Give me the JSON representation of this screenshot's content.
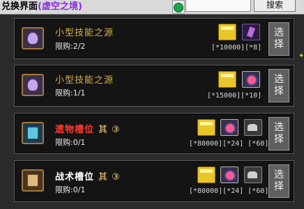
{
  "header": {
    "title": "兑换界面",
    "subtitle": "(虚空之境)",
    "search_button": "搜索",
    "search_value": ""
  },
  "rows": [
    {
      "name": "小型技能之源",
      "suffix": "",
      "limit": "限购:2/2",
      "cost_text": "[*10000][*8]",
      "cost_icons": [
        "gold-bar-icon",
        "purple-crystal-icon"
      ],
      "select_label_1": "选",
      "select_label_2": "择"
    },
    {
      "name": "小型技能之源",
      "suffix": "",
      "limit": "限购:1/1",
      "cost_text": "[*15000][*10]",
      "cost_icons": [
        "gold-bar-icon",
        "void-orb-icon"
      ],
      "select_label_1": "选",
      "select_label_2": "择"
    },
    {
      "name": "遗物槽位",
      "suffix": "其 ③",
      "limit": "限购:0/1",
      "cost_text": "[*80000][*24] [*60]",
      "cost_icons": [
        "gold-bar-icon",
        "void-orb-icon",
        "stone-icon"
      ],
      "select_label_1": "选",
      "select_label_2": "择"
    },
    {
      "name": "战术槽位",
      "suffix": "其 ③",
      "limit": "限购:0/1",
      "cost_text": "[*80000][*24] [*60]",
      "cost_icons": [
        "gold-bar-icon",
        "void-orb-icon",
        "stone-icon"
      ],
      "select_label_1": "选",
      "select_label_2": "择"
    }
  ],
  "colors": {
    "name_gold": "#d2b04a",
    "name_red": "#ff3b2a",
    "title_subtitle": "#8a2be2"
  }
}
